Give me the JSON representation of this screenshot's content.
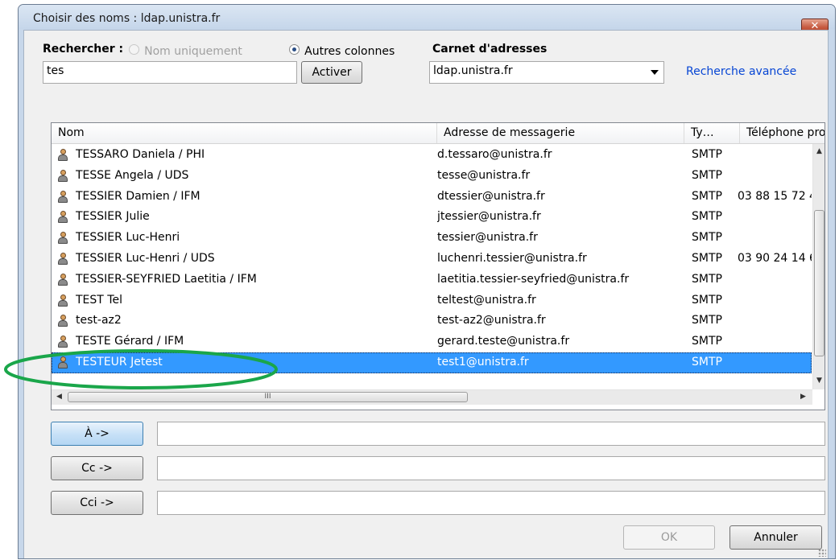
{
  "window": {
    "title": "Choisir des noms : ldap.unistra.fr",
    "close_glyph": "✕"
  },
  "search": {
    "label": "Rechercher :",
    "option_names_only": "Nom uniquement",
    "option_other_columns": "Autres colonnes",
    "selected_option": "Autres colonnes",
    "input_value": "tes",
    "activate_button": "Activer"
  },
  "address_book": {
    "label": "Carnet d'adresses",
    "selected_value": "ldap.unistra.fr",
    "dropdown_icon": "chevron-down-icon",
    "advanced_search_link": "Recherche avancée"
  },
  "results": {
    "columns": [
      "Nom",
      "Adresse de messagerie",
      "Ty…",
      "Téléphone profe"
    ],
    "rows": [
      {
        "name": "TESSARO Daniela / PHI",
        "email": "d.tessaro@unistra.fr",
        "type": "SMTP",
        "phone": ""
      },
      {
        "name": "TESSE Angela / UDS",
        "email": "tesse@unistra.fr",
        "type": "SMTP",
        "phone": ""
      },
      {
        "name": "TESSIER Damien / IFM",
        "email": "dtessier@unistra.fr",
        "type": "SMTP",
        "phone": "03 88 15 72 4"
      },
      {
        "name": "TESSIER Julie",
        "email": "jtessier@unistra.fr",
        "type": "SMTP",
        "phone": ""
      },
      {
        "name": "TESSIER Luc-Henri",
        "email": "tessier@unistra.fr",
        "type": "SMTP",
        "phone": ""
      },
      {
        "name": "TESSIER Luc-Henri / UDS",
        "email": "luchenri.tessier@unistra.fr",
        "type": "SMTP",
        "phone": "03 90 24 14 6"
      },
      {
        "name": "TESSIER-SEYFRIED Laetitia / IFM",
        "email": "laetitia.tessier-seyfried@unistra.fr",
        "type": "SMTP",
        "phone": ""
      },
      {
        "name": "TEST Tel",
        "email": "teltest@unistra.fr",
        "type": "SMTP",
        "phone": ""
      },
      {
        "name": "test-az2",
        "email": "test-az2@unistra.fr",
        "type": "SMTP",
        "phone": ""
      },
      {
        "name": "TESTE Gérard / IFM",
        "email": "gerard.teste@unistra.fr",
        "type": "SMTP",
        "phone": ""
      },
      {
        "name": "TESTEUR Jetest",
        "email": "test1@unistra.fr",
        "type": "SMTP",
        "phone": ""
      }
    ],
    "selected_row": "TESTEUR Jetest",
    "row_icon": "person-icon",
    "hscroll_grip": "III"
  },
  "recipients": {
    "to_button": "À ->",
    "to_value": "",
    "cc_button": "Cc ->",
    "cc_value": "",
    "bcc_button": "Cci ->",
    "bcc_value": ""
  },
  "footer": {
    "ok_button": "OK",
    "cancel_button": "Annuler"
  },
  "colors": {
    "selection": "#3399ff",
    "annotation_ellipse": "#1aa64a",
    "link": "#0645d4",
    "close_button": "#c65a40"
  }
}
